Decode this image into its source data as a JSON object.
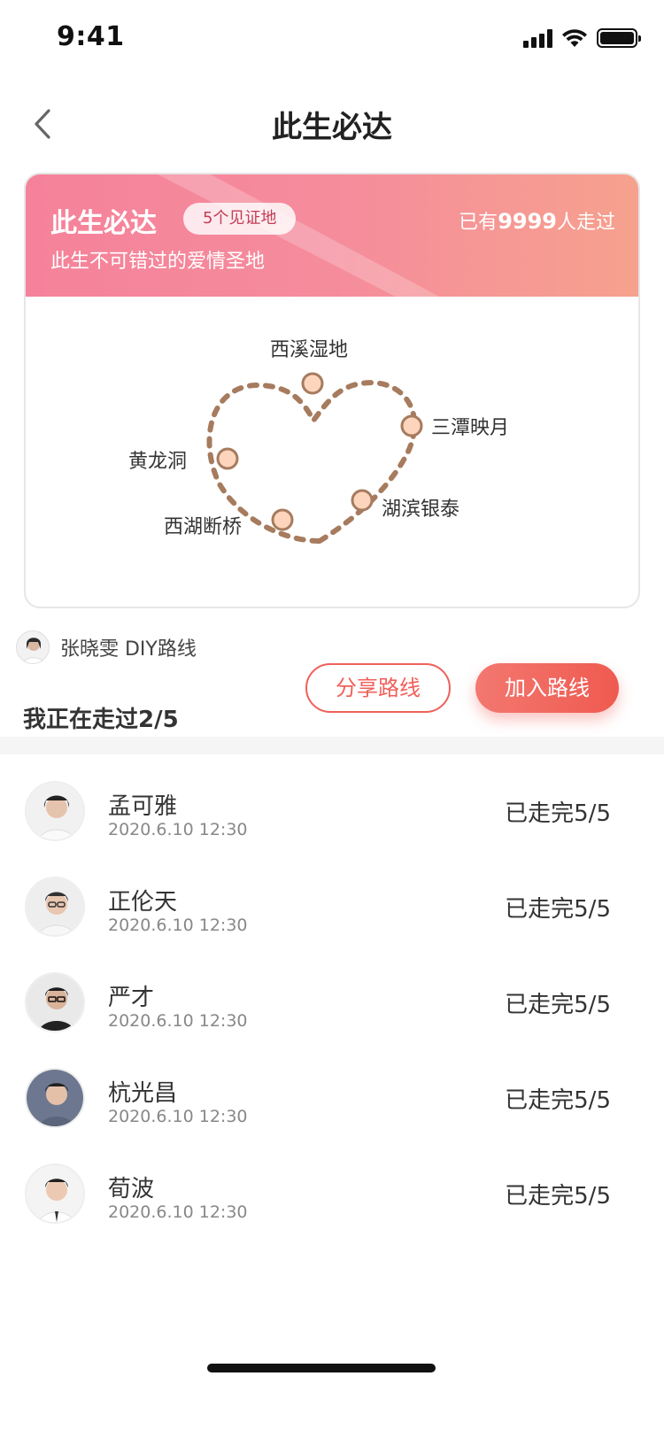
{
  "status_bar": {
    "time": "9:41"
  },
  "nav": {
    "title": "此生必达"
  },
  "route_card": {
    "title": "此生必达",
    "badge": "5个见证地",
    "subtitle": "此生不可错过的爱情圣地",
    "walked_prefix": "已有",
    "walked_count": "9999",
    "walked_suffix": "人走过",
    "header_gradient": [
      "#f5829a",
      "#f6a18e"
    ],
    "route_color": "#a67b5e",
    "stop_fill": "#fdd5bd",
    "places": [
      "西溪湿地",
      "三潭映月",
      "黄龙洞",
      "湖滨银泰",
      "西湖断桥"
    ]
  },
  "owner": {
    "text": "张晓雯 DIY路线"
  },
  "progress": {
    "text": "我正在走过2/5"
  },
  "actions": {
    "share": "分享路线",
    "join": "加入路线"
  },
  "participants": [
    {
      "name": "孟可雅",
      "time": "2020.6.10 12:30",
      "status": "已走完5/5"
    },
    {
      "name": "正伦天",
      "time": "2020.6.10 12:30",
      "status": "已走完5/5"
    },
    {
      "name": "严才",
      "time": "2020.6.10 12:30",
      "status": "已走完5/5"
    },
    {
      "name": "杭光昌",
      "time": "2020.6.10 12:30",
      "status": "已走完5/5"
    },
    {
      "name": "荀波",
      "time": "2020.6.10 12:30",
      "status": "已走完5/5"
    }
  ],
  "accent_color": "#f0605a"
}
